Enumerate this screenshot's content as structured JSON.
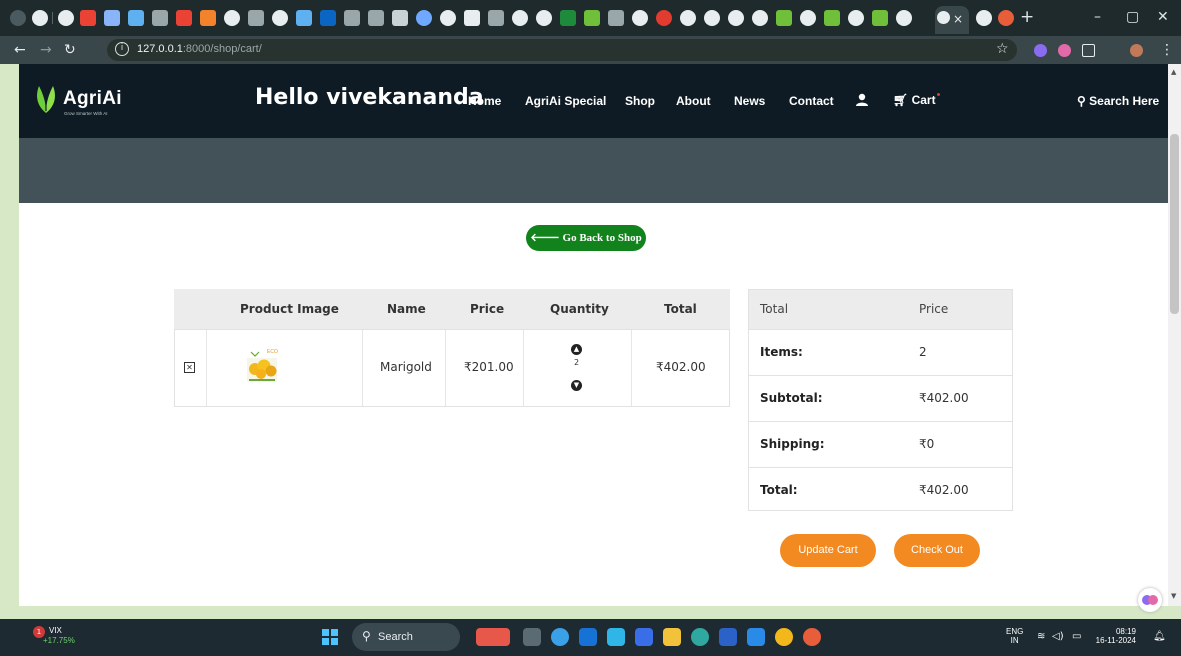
{
  "browser": {
    "url_host": "127.0.0.1",
    "url_path": ":8000/shop/cart/",
    "tab_close": "×",
    "new_tab": "+"
  },
  "header": {
    "logo_text": "AgriAi",
    "logo_tagline": "Grow Smarter With AI",
    "greeting": "Hello vivekananda",
    "nav": {
      "home": "Home",
      "special": "AgriAi Special",
      "shop": "Shop",
      "about": "About",
      "news": "News",
      "contact": "Contact",
      "cart": "Cart"
    },
    "search": "Search Here"
  },
  "page": {
    "back_button": "Go Back to Shop"
  },
  "cart_table": {
    "headers": {
      "image": "Product Image",
      "name": "Name",
      "price": "Price",
      "quantity": "Quantity",
      "total": "Total"
    },
    "row": {
      "name": "Marigold",
      "price": "₹201.00",
      "quantity": "2",
      "total": "₹402.00"
    }
  },
  "summary": {
    "head_left": "Total",
    "head_right": "Price",
    "rows": [
      {
        "label": "Items:",
        "value": "2"
      },
      {
        "label": "Subtotal:",
        "value": "₹402.00"
      },
      {
        "label": "Shipping:",
        "value": "₹0"
      },
      {
        "label": "Total:",
        "value": "₹402.00"
      }
    ]
  },
  "buttons": {
    "update_cart": "Update Cart",
    "check_out": "Check Out"
  },
  "taskbar": {
    "vix_label": "VIX",
    "vix_change": "+17.75%",
    "search": "Search",
    "lang_top": "ENG",
    "lang_bottom": "IN",
    "time": "08:19",
    "date": "16-11-2024"
  },
  "colors": {
    "header_bg": "#0e1b24",
    "hero_bg": "#435159",
    "back_button": "#12831c",
    "action_button": "#f28a21"
  }
}
